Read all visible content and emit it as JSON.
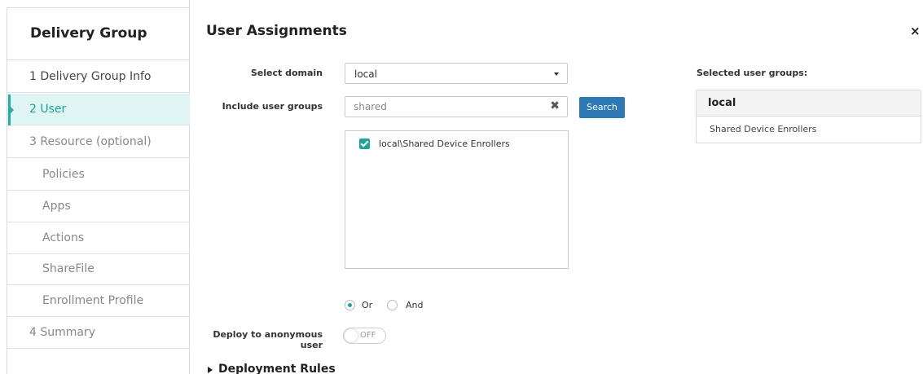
{
  "sidebar": {
    "title": "Delivery Group",
    "items": [
      {
        "label": "1 Delivery Group Info"
      },
      {
        "label": "2 User"
      },
      {
        "label": "3 Resource (optional)"
      },
      {
        "label": "Policies"
      },
      {
        "label": "Apps"
      },
      {
        "label": "Actions"
      },
      {
        "label": "ShareFile"
      },
      {
        "label": "Enrollment Profile"
      },
      {
        "label": "4 Summary"
      }
    ]
  },
  "main": {
    "title": "User Assignments",
    "close_icon": "×",
    "select_domain": {
      "label": "Select domain",
      "value": "local"
    },
    "include_user_groups": {
      "label": "Include user groups",
      "value": "shared",
      "clear_icon": "✖"
    },
    "search_button": "Search",
    "results": [
      {
        "label": "local\\Shared Device Enrollers",
        "checked": true
      }
    ],
    "logic": {
      "or_label": "Or",
      "and_label": "And",
      "selected": "Or"
    },
    "deploy_anonymous": {
      "label": "Deploy to anonymous user",
      "state": "OFF"
    },
    "deployment_rules": "Deployment Rules"
  },
  "selected_groups": {
    "title": "Selected user groups:",
    "group": "local",
    "items": [
      "Shared Device Enrollers"
    ]
  },
  "colors": {
    "accent": "#1fa49c",
    "button": "#2d79b6",
    "active_bg": "#dff5f3"
  }
}
